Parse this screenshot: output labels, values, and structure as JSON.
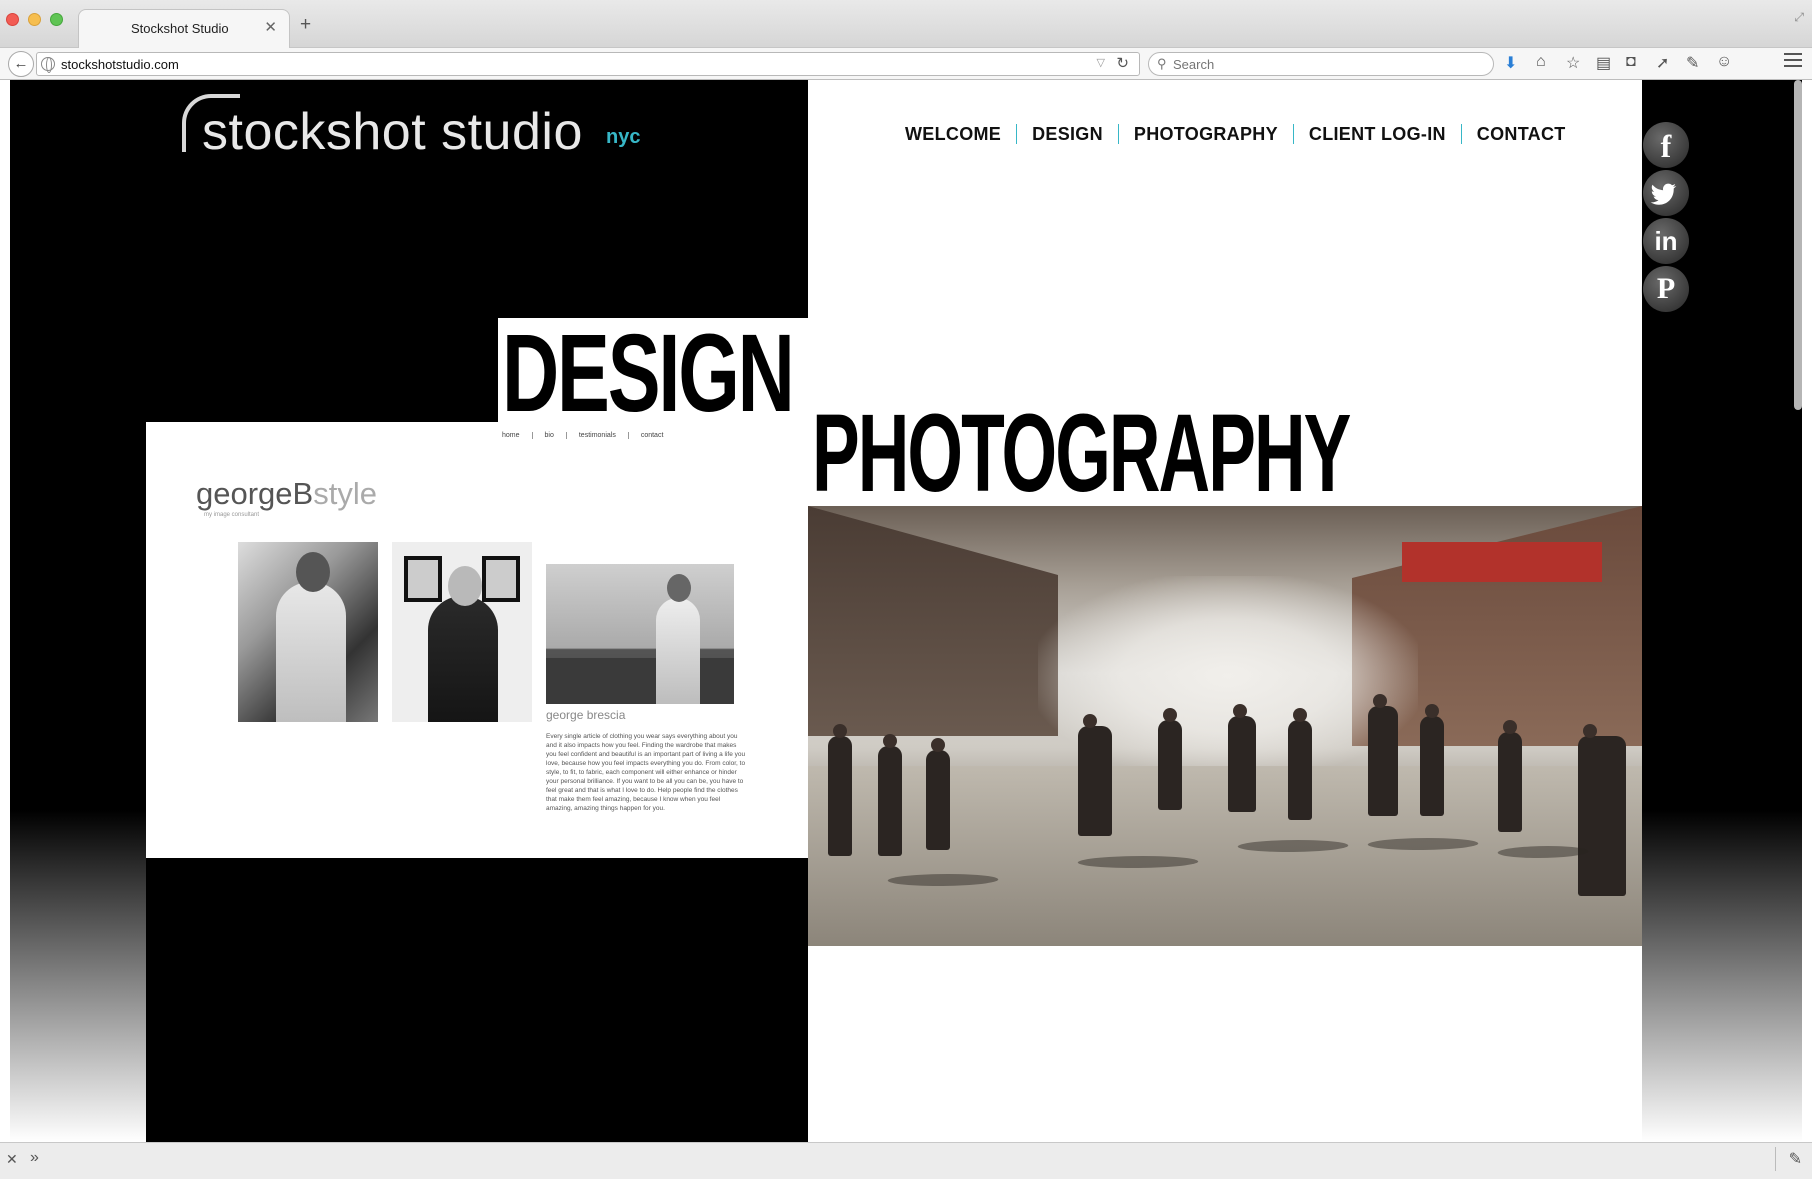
{
  "browser": {
    "tab_title": "Stockshot Studio",
    "url": "stockshotstudio.com",
    "search_placeholder": "Search"
  },
  "site": {
    "logo_main": "stockshot studio",
    "logo_sub": "nyc",
    "nav": [
      "WELCOME",
      "DESIGN",
      "PHOTOGRAPHY",
      "CLIENT LOG-IN",
      "CONTACT"
    ],
    "social": {
      "facebook": "f",
      "linkedin": "in",
      "pinterest": "P"
    },
    "headings": {
      "design": "DESIGN",
      "photography": "PHOTOGRAPHY"
    }
  },
  "design_preview": {
    "nav": [
      "home",
      "bio",
      "testimonials",
      "contact"
    ],
    "brand_dark": "georgeB",
    "brand_light": "style",
    "tagline": "my image consultant",
    "caption": "george brescia",
    "body": "Every single article of clothing you wear says everything about you and it also impacts how you feel. Finding the wardrobe that makes you feel confident and beautiful is an important part of living a life you love, because how you feel impacts everything you do. From color, to style, to fit, to fabric, each component will either enhance or hinder your personal brilliance. If you want to be all you can be, you have to feel great and that is what I love to do. Help people find the clothes that make them feel amazing, because I know when you feel amazing, amazing things happen for you."
  }
}
